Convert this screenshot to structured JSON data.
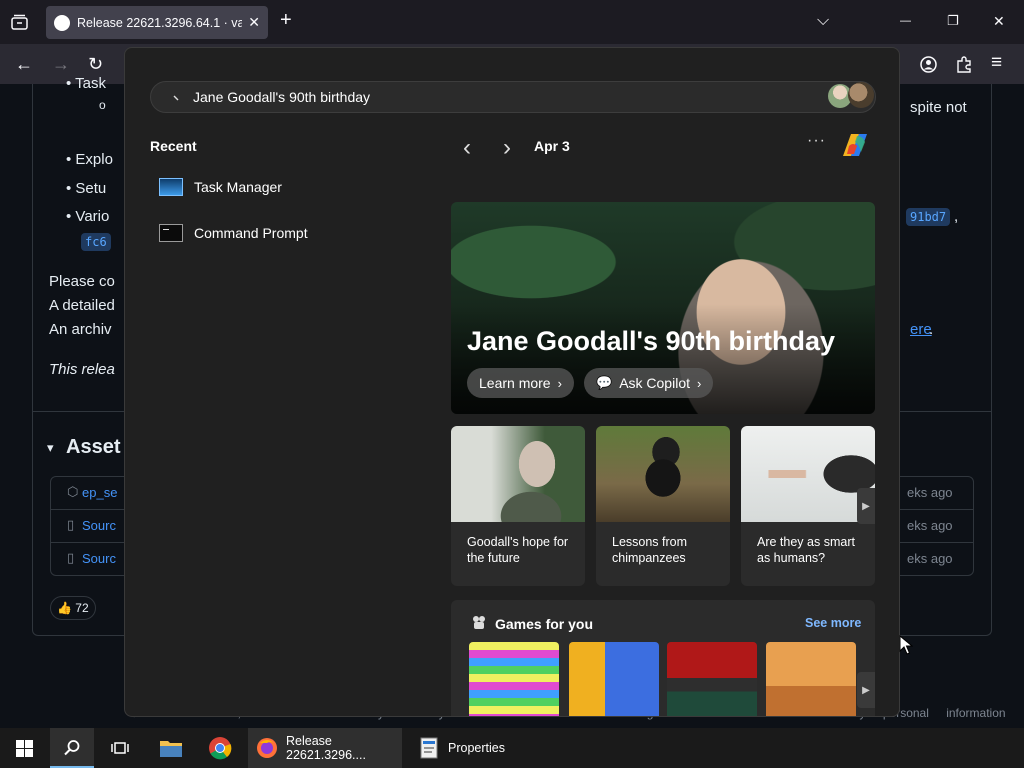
{
  "browser": {
    "tab_title": "Release 22621.3296.64.1 · valinet",
    "tab_close": "✕",
    "new_tab": "+",
    "list_all_tabs": "⌵",
    "minimize": "—",
    "maximize": "❐",
    "close": "✕",
    "back": "←",
    "forward": "→",
    "reload": "↻",
    "menu": "≡"
  },
  "page": {
    "bullets": [
      "Task",
      "Explo",
      "Setu",
      "Vario"
    ],
    "sub_bullet": "o",
    "snippet_right": "spite not",
    "code_left": "fc6",
    "code_right": "91bd7",
    "code_right_comma": ",",
    "para1": "Please co",
    "para2": "A detailed",
    "para3": "An archiv",
    "link_right": "ere",
    "link_right_period": ".",
    "note": "This relea",
    "assets_toggle": "▾",
    "assets_heading": "Asset",
    "asset_rows": [
      {
        "name": "ep_se",
        "time": "eks ago"
      },
      {
        "name": "Sourc",
        "time": "eks ago"
      },
      {
        "name": "Sourc",
        "time": "eks ago"
      }
    ],
    "reaction_count": "72",
    "reaction_emoji": "👍",
    "footer": "© 2024 GitHub, Inc. Terms Privacy Security Status Docs Contact Manage cookies Do not share my personal information"
  },
  "search": {
    "query": "Jane Goodall's 90th birthday",
    "recent_heading": "Recent",
    "recent_items": [
      {
        "label": "Task Manager",
        "icon": "task-manager-icon"
      },
      {
        "label": "Command Prompt",
        "icon": "command-prompt-icon"
      }
    ],
    "date": "Apr 3",
    "prev": "‹",
    "next": "›",
    "more": "···",
    "hero": {
      "title": "Jane Goodall's 90th birthday",
      "learn_more": "Learn more",
      "ask_copilot": "Ask Copilot",
      "chevron": "›",
      "bubble": "💬"
    },
    "news": [
      {
        "caption": "Goodall's hope for the future"
      },
      {
        "caption": "Lessons from chimpanzees"
      },
      {
        "caption": "Are they as smart as humans?"
      }
    ],
    "carousel_next": "▶",
    "games": {
      "title": "Games for you",
      "see_more": "See more"
    }
  },
  "taskbar": {
    "firefox_label": "Release 22621.3296....",
    "properties_label": "Properties"
  },
  "colors": {
    "accent_link": "#7fb8ff",
    "taskbar_indicator": "#76b9ed",
    "panel_bg": "#202020"
  }
}
